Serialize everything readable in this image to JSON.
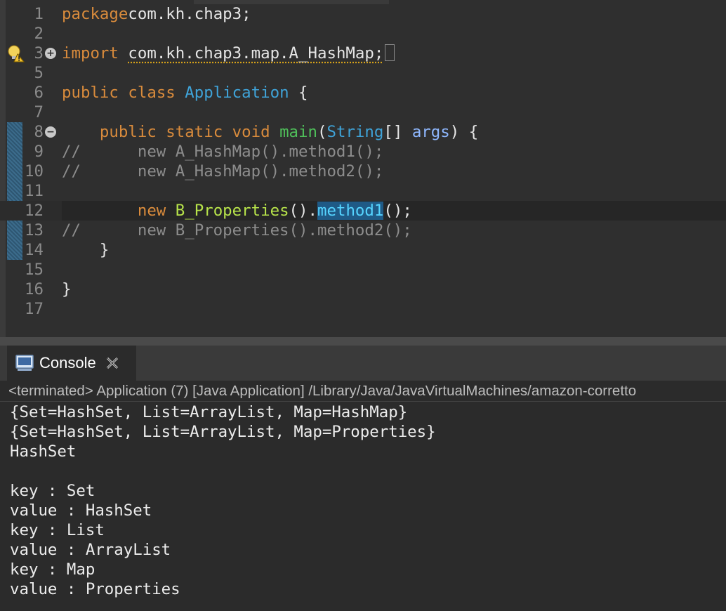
{
  "editor": {
    "lines": [
      {
        "num": "1",
        "parts": [
          [
            "kw",
            "package"
          ],
          [
            "",
            "com.kh.chap3;"
          ]
        ]
      },
      {
        "num": "2",
        "parts": []
      },
      {
        "num": "3",
        "fold": "+",
        "warn": true,
        "parts": [
          [
            "kw",
            "import"
          ],
          [
            "",
            "␣"
          ],
          [
            "warnline",
            "com.kh.chap3.map.A_HashMap;"
          ]
        ],
        "collapsed": true
      },
      {
        "num": "5",
        "parts": []
      },
      {
        "num": "6",
        "parts": [
          [
            "kw",
            "public"
          ],
          [
            "",
            " "
          ],
          [
            "kw",
            "class"
          ],
          [
            "",
            " "
          ],
          [
            "ty",
            "Application"
          ],
          [
            "",
            " {"
          ]
        ]
      },
      {
        "num": "7",
        "parts": []
      },
      {
        "num": "8",
        "fold": "−",
        "parts": [
          [
            "",
            "    "
          ],
          [
            "kw",
            "public"
          ],
          [
            "",
            " "
          ],
          [
            "kw",
            "static"
          ],
          [
            "",
            " "
          ],
          [
            "kw",
            "void"
          ],
          [
            "",
            " "
          ],
          [
            "fn",
            "main"
          ],
          [
            "",
            "("
          ],
          [
            "ty",
            "String"
          ],
          [
            "",
            "[] "
          ],
          [
            "param",
            "args"
          ],
          [
            "",
            ") {"
          ]
        ]
      },
      {
        "num": "9",
        "parts": [
          [
            "cm",
            "//      new A_HashMap().method1();"
          ]
        ]
      },
      {
        "num": "10",
        "parts": [
          [
            "cm",
            "//      new A_HashMap().method2();"
          ]
        ]
      },
      {
        "num": "11",
        "parts": []
      },
      {
        "num": "12",
        "current": true,
        "parts": [
          [
            "",
            "        "
          ],
          [
            "kw",
            "new"
          ],
          [
            "",
            " "
          ],
          [
            "cls",
            "B_Properties"
          ],
          [
            "",
            "()."
          ],
          [
            "sel",
            "method1"
          ],
          [
            "",
            "();"
          ]
        ]
      },
      {
        "num": "13",
        "parts": [
          [
            "cm",
            "//      new B_Properties().method2();"
          ]
        ]
      },
      {
        "num": "14",
        "parts": [
          [
            "",
            "    }"
          ]
        ]
      },
      {
        "num": "15",
        "parts": []
      },
      {
        "num": "16",
        "parts": [
          [
            "",
            "}"
          ]
        ]
      },
      {
        "num": "17",
        "parts": []
      }
    ]
  },
  "console": {
    "tab_label": "Console",
    "status": "<terminated> Application (7) [Java Application] /Library/Java/JavaVirtualMachines/amazon-corretto",
    "output": [
      "{Set=HashSet, List=ArrayList, Map=HashMap}",
      "{Set=HashSet, List=ArrayList, Map=Properties}",
      "HashSet",
      "",
      "key : Set",
      "value : HashSet",
      "key : List",
      "value : ArrayList",
      "key : Map",
      "value : Properties"
    ]
  },
  "colors": {
    "keyword": "#d98b3c",
    "type": "#3fa3d8",
    "method": "#4fbf5a",
    "class": "#b7e34a",
    "comment": "#8d8d8d"
  }
}
